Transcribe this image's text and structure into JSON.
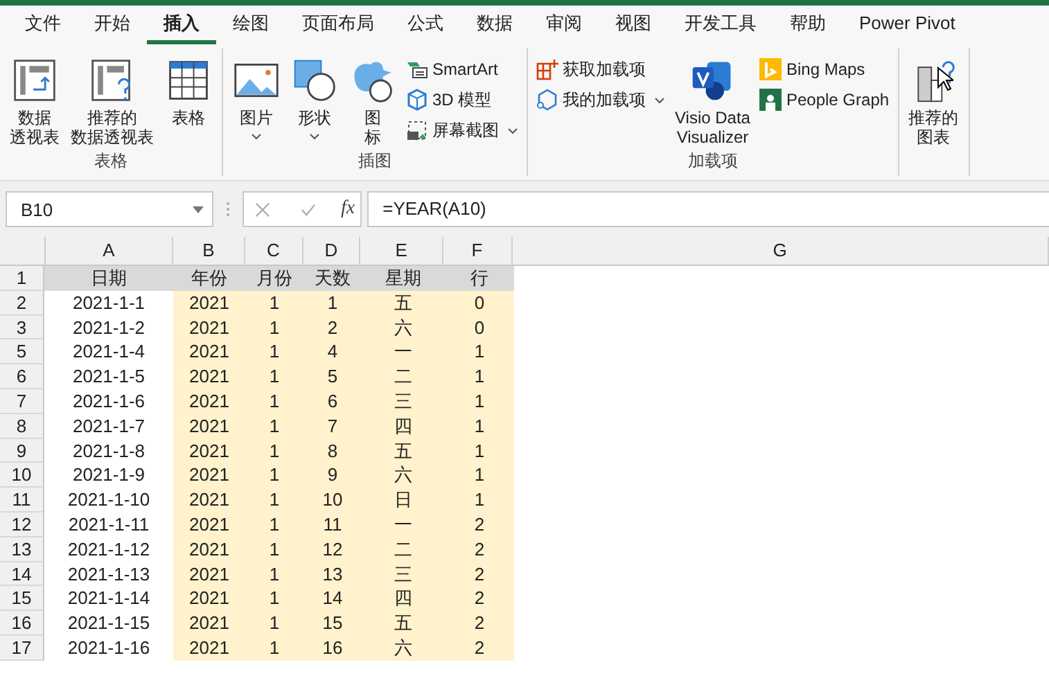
{
  "ribbon": {
    "tabs": [
      {
        "label": "文件",
        "selected": false
      },
      {
        "label": "开始",
        "selected": false
      },
      {
        "label": "插入",
        "selected": true
      },
      {
        "label": "绘图",
        "selected": false
      },
      {
        "label": "页面布局",
        "selected": false
      },
      {
        "label": "公式",
        "selected": false
      },
      {
        "label": "数据",
        "selected": false
      },
      {
        "label": "审阅",
        "selected": false
      },
      {
        "label": "视图",
        "selected": false
      },
      {
        "label": "开发工具",
        "selected": false
      },
      {
        "label": "帮助",
        "selected": false
      },
      {
        "label": "Power Pivot",
        "selected": false
      }
    ],
    "groups": [
      {
        "label": "表格",
        "items": [
          {
            "kind": "large",
            "lines": [
              "数据",
              "透视表"
            ],
            "dropdown": false
          },
          {
            "kind": "large",
            "lines": [
              "推荐的",
              "数据透视表"
            ],
            "dropdown": false
          },
          {
            "kind": "large",
            "lines": [
              "表格"
            ],
            "dropdown": false
          }
        ]
      },
      {
        "label": "插图",
        "items": [
          {
            "kind": "large",
            "lines": [
              "图片"
            ],
            "dropdown": true
          },
          {
            "kind": "large",
            "lines": [
              "形状"
            ],
            "dropdown": true
          },
          {
            "kind": "large",
            "lines": [
              "图",
              "标"
            ],
            "dropdown": false
          },
          {
            "kind": "small",
            "lines": [
              "SmartArt"
            ],
            "dropdown": false
          },
          {
            "kind": "small",
            "lines": [
              "3D 模型"
            ],
            "dropdown": false
          },
          {
            "kind": "small",
            "lines": [
              "屏幕截图"
            ],
            "dropdown": true
          }
        ]
      },
      {
        "label": "加载项",
        "items": [
          {
            "kind": "small",
            "lines": [
              "获取加载项"
            ],
            "dropdown": false
          },
          {
            "kind": "small",
            "lines": [
              "我的加载项"
            ],
            "dropdown": true
          },
          {
            "kind": "large",
            "lines": [
              "Visio Data",
              "Visualizer"
            ],
            "dropdown": false
          },
          {
            "kind": "small",
            "lines": [
              "Bing Maps"
            ],
            "dropdown": false
          },
          {
            "kind": "small",
            "lines": [
              "People Graph"
            ],
            "dropdown": false
          }
        ]
      },
      {
        "items": [
          {
            "kind": "large",
            "lines": [
              "推荐的",
              "图表"
            ],
            "dropdown": false
          }
        ]
      }
    ]
  },
  "formula_bar": {
    "name_box": "B10",
    "function_label": "fx",
    "formula": "=YEAR(A10)"
  },
  "sheet": {
    "columns": [
      "A",
      "B",
      "C",
      "D",
      "E",
      "F",
      "G"
    ],
    "rows": [
      {
        "number": "1",
        "kind": "header",
        "cells": [
          "日期",
          "年份",
          "月份",
          "天数",
          "星期",
          "行"
        ]
      },
      {
        "number": "2",
        "kind": "data",
        "cells": [
          "2021-1-1",
          "2021",
          "1",
          "1",
          "五",
          "0"
        ]
      },
      {
        "number": "3",
        "kind": "data",
        "cells": [
          "2021-1-2",
          "2021",
          "1",
          "2",
          "六",
          "0"
        ]
      },
      {
        "number": "5",
        "kind": "data",
        "cells": [
          "2021-1-4",
          "2021",
          "1",
          "4",
          "一",
          "1"
        ]
      },
      {
        "number": "6",
        "kind": "data",
        "cells": [
          "2021-1-5",
          "2021",
          "1",
          "5",
          "二",
          "1"
        ]
      },
      {
        "number": "7",
        "kind": "data",
        "cells": [
          "2021-1-6",
          "2021",
          "1",
          "6",
          "三",
          "1"
        ]
      },
      {
        "number": "8",
        "kind": "data",
        "cells": [
          "2021-1-7",
          "2021",
          "1",
          "7",
          "四",
          "1"
        ]
      },
      {
        "number": "9",
        "kind": "data",
        "cells": [
          "2021-1-8",
          "2021",
          "1",
          "8",
          "五",
          "1"
        ]
      },
      {
        "number": "10",
        "kind": "data",
        "cells": [
          "2021-1-9",
          "2021",
          "1",
          "9",
          "六",
          "1"
        ]
      },
      {
        "number": "11",
        "kind": "data",
        "cells": [
          "2021-1-10",
          "2021",
          "1",
          "10",
          "日",
          "1"
        ]
      },
      {
        "number": "12",
        "kind": "data",
        "cells": [
          "2021-1-11",
          "2021",
          "1",
          "11",
          "一",
          "2"
        ]
      },
      {
        "number": "13",
        "kind": "data",
        "cells": [
          "2021-1-12",
          "2021",
          "1",
          "12",
          "二",
          "2"
        ]
      },
      {
        "number": "14",
        "kind": "data",
        "cells": [
          "2021-1-13",
          "2021",
          "1",
          "13",
          "三",
          "2"
        ]
      },
      {
        "number": "15",
        "kind": "data",
        "cells": [
          "2021-1-14",
          "2021",
          "1",
          "14",
          "四",
          "2"
        ]
      },
      {
        "number": "16",
        "kind": "data",
        "cells": [
          "2021-1-15",
          "2021",
          "1",
          "15",
          "五",
          "2"
        ]
      },
      {
        "number": "17",
        "kind": "data",
        "cells": [
          "2021-1-16",
          "2021",
          "1",
          "16",
          "六",
          "2"
        ]
      }
    ]
  }
}
